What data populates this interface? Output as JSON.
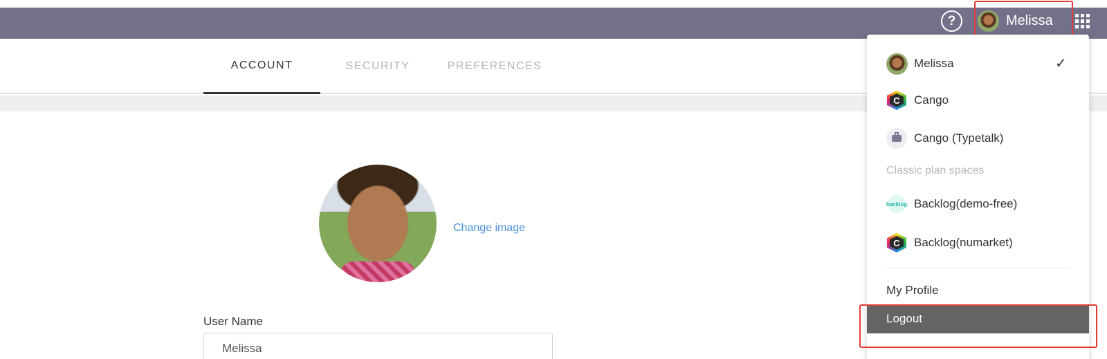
{
  "header": {
    "help_label": "?",
    "user_name": "Melissa"
  },
  "tabs": [
    {
      "label": "ACCOUNT",
      "active": true
    },
    {
      "label": "SECURITY",
      "active": false
    },
    {
      "label": "PREFERENCES",
      "active": false
    }
  ],
  "profile": {
    "change_image_label": "Change image",
    "user_name_label": "User Name",
    "user_name_value": "Melissa"
  },
  "dropdown": {
    "spaces": [
      {
        "label": "Melissa",
        "icon": "user-avatar-icon",
        "selected": true
      },
      {
        "label": "Cango",
        "icon": "cango-logo-icon",
        "selected": false
      },
      {
        "label": "Cango (Typetalk)",
        "icon": "briefcase-icon",
        "selected": false
      }
    ],
    "section_label": "Classic plan spaces",
    "classic_spaces": [
      {
        "label": "Backlog(demo-free)",
        "icon": "backlog-logo-icon"
      },
      {
        "label": "Backlog(numarket)",
        "icon": "cango-logo-icon"
      }
    ],
    "backlog_logo_text": "backlog",
    "cango_logo_letter": "C",
    "check_glyph": "✓",
    "my_profile_label": "My Profile",
    "logout_label": "Logout"
  },
  "colors": {
    "topbar": "#727189",
    "link": "#4a90d9",
    "highlight": "#e53935",
    "logout_bg": "#646464"
  }
}
